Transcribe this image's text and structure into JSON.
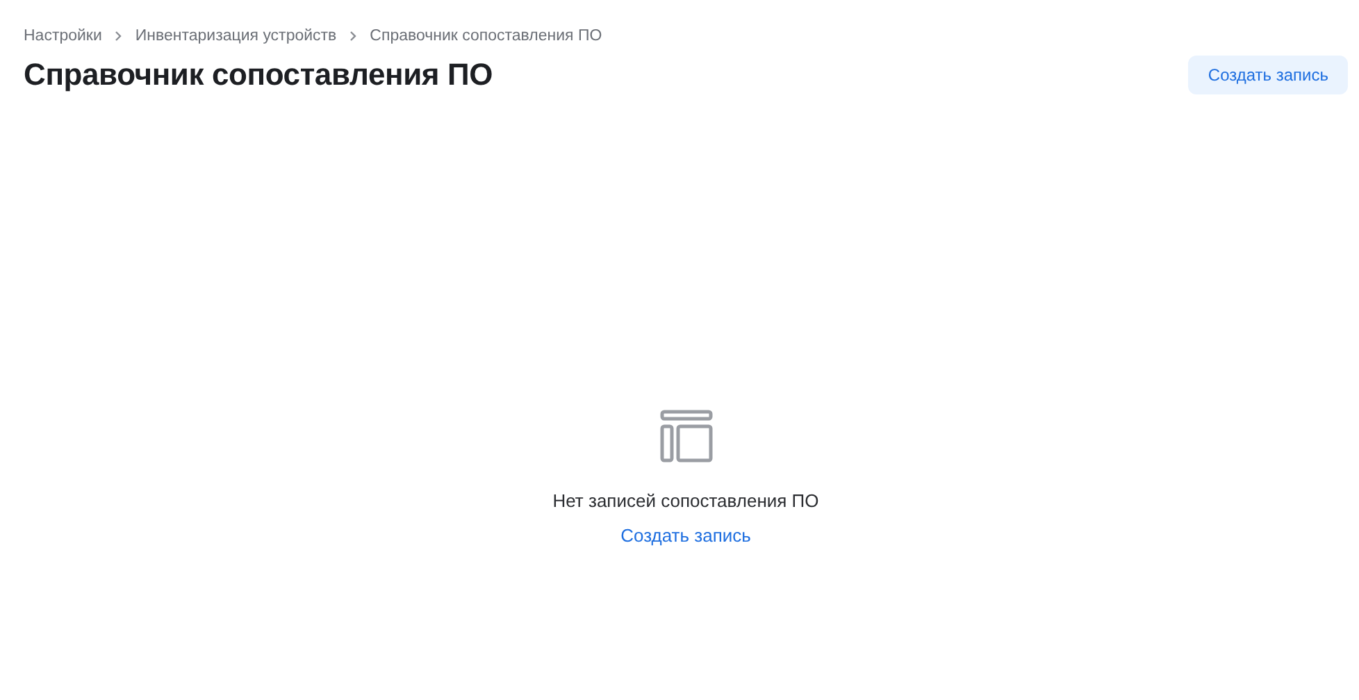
{
  "breadcrumbs": [
    {
      "label": "Настройки"
    },
    {
      "label": "Инвентаризация устройств"
    },
    {
      "label": "Справочник сопоставления ПО"
    }
  ],
  "header": {
    "title": "Справочник сопоставления ПО",
    "action_button": "Создать запись"
  },
  "empty_state": {
    "message": "Нет записей сопоставления ПО",
    "link": "Создать запись"
  }
}
